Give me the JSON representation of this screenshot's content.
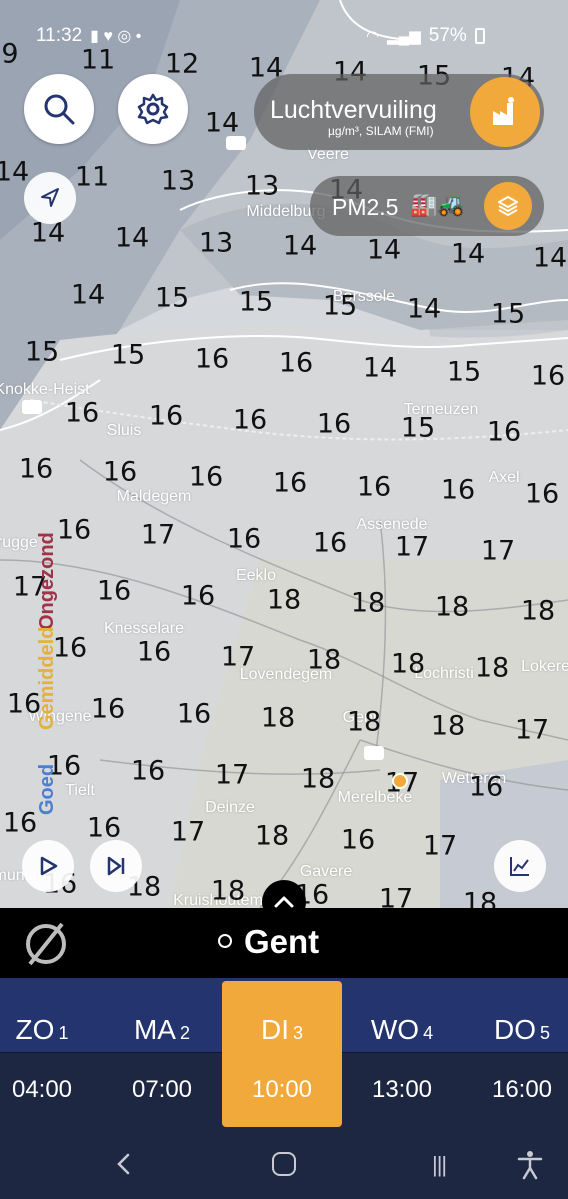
{
  "status_bar": {
    "time": "11:32",
    "battery": "57%"
  },
  "buttons": {
    "layer_title": "Luchtvervuiling",
    "layer_subtitle": "µg/m³, SILAM (FMI)",
    "pollutant": "PM2.5"
  },
  "legend": {
    "good": "Goed",
    "moderate": "Gemiddeld",
    "unhealthy": "Ongezond"
  },
  "colors": {
    "accent": "#f0a93a",
    "good": "#4d7fd1",
    "moderate": "#e3b13c",
    "unhealthy": "#a0324a",
    "day_bar": "#24346e",
    "day_bg": "#1d2742"
  },
  "places": [
    "Veere",
    "Middelburg",
    "Borssele",
    "Knokke-Heist",
    "Sluis",
    "Terneuzen",
    "Axel",
    "Maldegem",
    "Assenede",
    "Brugge",
    "Eeklo",
    "Knesselare",
    "Lovendegem",
    "Lochristi",
    "Lokeren",
    "Wingene",
    "Gent",
    "Tielt",
    "Merelbeke",
    "Wetteren",
    "Deinze",
    "Gavere",
    "Kruishoutem",
    "Ielmunster"
  ],
  "values": [
    "9",
    "11",
    "12",
    "14",
    "14",
    "15",
    "14",
    "14",
    "14",
    "11",
    "13",
    "13",
    "14",
    "14",
    "14",
    "13",
    "14",
    "14",
    "14",
    "14",
    "14",
    "15",
    "15",
    "15",
    "14",
    "15",
    "15",
    "15",
    "16",
    "16",
    "14",
    "15",
    "16",
    "16",
    "16",
    "16",
    "16",
    "15",
    "16",
    "16",
    "16",
    "16",
    "16",
    "16",
    "16",
    "16",
    "16",
    "17",
    "16",
    "16",
    "17",
    "17",
    "17",
    "16",
    "16",
    "18",
    "18",
    "18",
    "18",
    "16",
    "16",
    "17",
    "18",
    "18",
    "18",
    "16",
    "16",
    "16",
    "18",
    "18",
    "18",
    "17",
    "16",
    "16",
    "17",
    "18",
    "17",
    "16",
    "16",
    "16",
    "17",
    "18",
    "16",
    "17",
    "16",
    "18",
    "18",
    "16",
    "17",
    "18",
    "16",
    "15"
  ],
  "location": {
    "name": "Gent"
  },
  "days": [
    {
      "name": "ZO",
      "num": "1",
      "time": "04:00"
    },
    {
      "name": "MA",
      "num": "2",
      "time": "07:00"
    },
    {
      "name": "DI",
      "num": "3",
      "time": "10:00",
      "selected": true
    },
    {
      "name": "WO",
      "num": "4",
      "time": "13:00"
    },
    {
      "name": "DO",
      "num": "5",
      "time": "16:00"
    }
  ]
}
